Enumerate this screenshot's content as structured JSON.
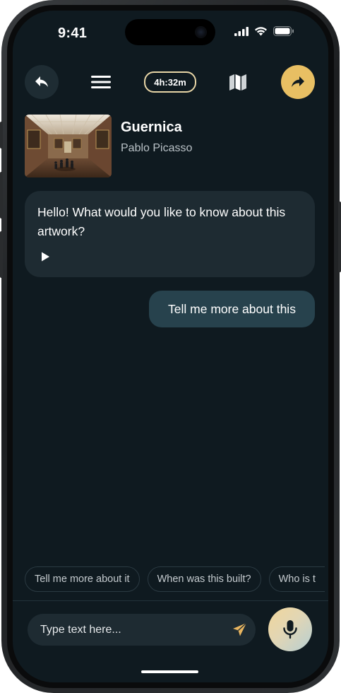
{
  "status_bar": {
    "time": "9:41",
    "icons": [
      "cellular-signal-icon",
      "wifi-icon",
      "battery-icon"
    ]
  },
  "toolbar": {
    "back_icon": "reply-arrow-icon",
    "menu_icon": "hamburger-menu-icon",
    "timer": "4h:32m",
    "map_icon": "map-icon",
    "share_icon": "share-arrow-icon"
  },
  "artwork": {
    "title": "Guernica",
    "artist": "Pablo Picasso",
    "thumbnail": "museum-gallery-photo"
  },
  "messages": [
    {
      "sender": "bot",
      "text": "Hello! What would you like to know about this artwork?",
      "action_icon": "play-icon"
    },
    {
      "sender": "user",
      "text": "Tell me more about this"
    }
  ],
  "suggestions": [
    {
      "label": "Tell me more about it"
    },
    {
      "label": "When was this built?"
    },
    {
      "label": "Who is t"
    }
  ],
  "composer": {
    "placeholder": "Type text here...",
    "value": "",
    "send_icon": "send-paper-plane-icon",
    "mic_icon": "microphone-icon"
  },
  "colors": {
    "background": "#0f1a20",
    "bubble_bot": "#1e2b32",
    "bubble_user": "#27424d",
    "accent_gold": "#e8bf63",
    "timer_border": "#e7d5a6"
  }
}
